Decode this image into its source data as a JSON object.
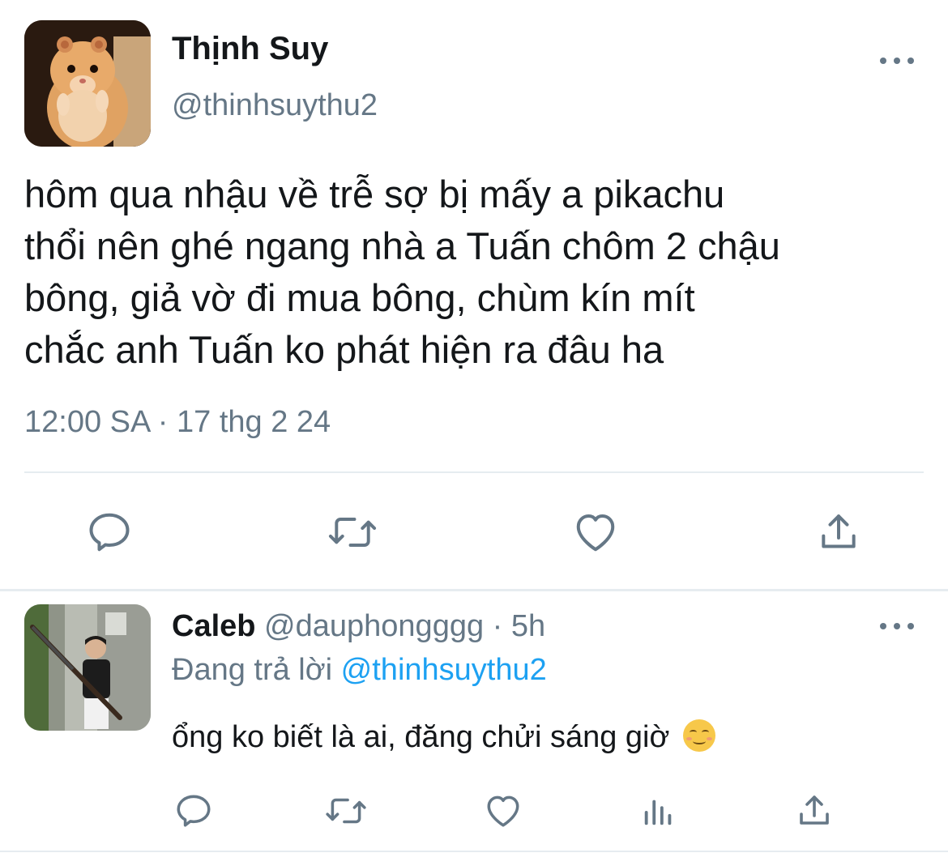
{
  "main_tweet": {
    "author_name": "Thịnh Suy",
    "author_handle": "@thinhsuythu2",
    "avatar_icon": "hamster-avatar",
    "text_lines": [
      "hôm qua nhậu về trễ sợ bị mấy a pikachu",
      "thổi nên ghé ngang nhà a Tuấn chôm 2 chậu",
      "bông, giả vờ đi mua bông, chùm kín mít",
      "chắc anh Tuấn ko phát hiện ra đâu ha"
    ],
    "timestamp": "12:00 SA · 17 thg 2 24",
    "actions": [
      "reply-icon",
      "retweet-icon",
      "like-icon",
      "share-icon"
    ],
    "more_icon": "more-options-icon"
  },
  "reply": {
    "author_name": "Caleb",
    "author_handle": "@dauphongggg",
    "time": "· 5h",
    "avatar_icon": "boy-with-gun-avatar",
    "replying_prefix": "Đang trả lời",
    "replying_to": "@thinhsuythu2",
    "text": "ổng ko biết là ai, đăng chửi sáng giờ",
    "emoji": "smiling-face-emoji",
    "actions": [
      "reply-icon",
      "retweet-icon",
      "like-icon",
      "analytics-icon",
      "share-icon"
    ],
    "more_icon": "more-options-icon"
  },
  "colors": {
    "text": "#14171a",
    "secondary": "#657786",
    "accent": "#1da1f2",
    "divider": "#e6ecf0"
  }
}
